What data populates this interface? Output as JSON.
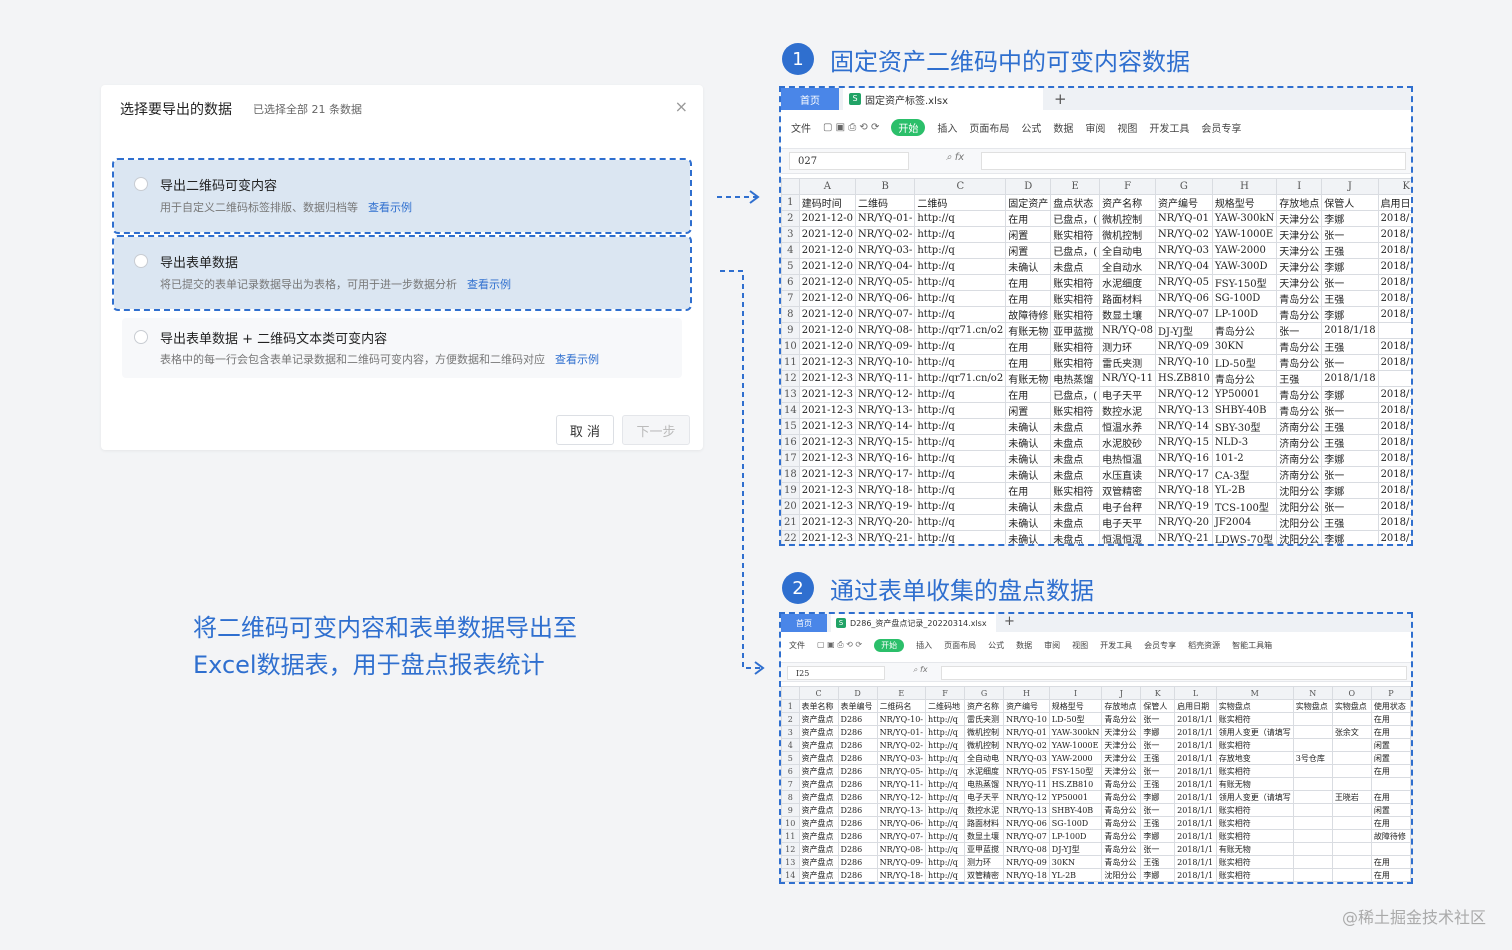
{
  "dialog": {
    "title": "选择要导出的数据",
    "subtitle": "已选择全部 21 条数据",
    "close": "×",
    "options": [
      {
        "title": "导出二维码可变内容",
        "desc": "用于自定义二维码标签排版、数据归档等",
        "link": "查看示例"
      },
      {
        "title": "导出表单数据",
        "desc": "将已提交的表单记录数据导出为表格，可用于进一步数据分析",
        "link": "查看示例"
      },
      {
        "title": "导出表单数据 + 二维码文本类可变内容",
        "desc": "表格中的每一行会包含表单记录数据和二维码可变内容，方便数据和二维码对应",
        "link": "查看示例"
      }
    ],
    "cancel": "取 消",
    "next": "下一步"
  },
  "caption": {
    "line1": "将二维码可变内容和表单数据导出至",
    "line2": "Excel数据表，用于盘点报表统计"
  },
  "section1": {
    "number": "1",
    "heading": "固定资产二维码中的可变内容数据"
  },
  "section2": {
    "number": "2",
    "heading": "通过表单收集的盘点数据"
  },
  "watermark": "@稀土掘金技术社区",
  "sheet1": {
    "home_tab": "首页",
    "file_name": "固定资产标签.xlsx",
    "plus": "+",
    "toolbar": [
      "文件",
      "开始",
      "插入",
      "页面布局",
      "公式",
      "数据",
      "审阅",
      "视图",
      "开发工具",
      "会员专享"
    ],
    "cell_ref": "027",
    "fx": "fx",
    "columns": [
      "A",
      "B",
      "C",
      "D",
      "E",
      "F",
      "G",
      "H",
      "I",
      "J",
      "K"
    ],
    "header_row": [
      "建码时间",
      "二维码",
      "二维码",
      "固定资产",
      "盘点状态",
      "资产名称",
      "资产编号",
      "规格型号",
      "存放地点",
      "保管人",
      "启用日期"
    ],
    "rows": [
      [
        "2021-12-0",
        "NR/YQ-01-",
        "http://q",
        "在用",
        "已盘点，(",
        "微机控制",
        "NR/YQ-01",
        "YAW-300kN",
        "天津分公",
        "李娜",
        "2018/1/18"
      ],
      [
        "2021-12-0",
        "NR/YQ-02-",
        "http://q",
        "闲置",
        "账实相符",
        "微机控制",
        "NR/YQ-02",
        "YAW-1000E",
        "天津分公",
        "张一",
        "2018/1/18"
      ],
      [
        "2021-12-0",
        "NR/YQ-03-",
        "http://q",
        "闲置",
        "已盘点，(",
        "全自动电",
        "NR/YQ-03",
        "YAW-2000",
        "天津分公",
        "王强",
        "2018/1/18"
      ],
      [
        "2021-12-0",
        "NR/YQ-04-",
        "http://q",
        "未确认",
        "未盘点",
        "全自动水",
        "NR/YQ-04",
        "YAW-300D",
        "天津分公",
        "李娜",
        "2018/1/18"
      ],
      [
        "2021-12-0",
        "NR/YQ-05-",
        "http://q",
        "在用",
        "账实相符",
        "水泥细度",
        "NR/YQ-05",
        "FSY-150型",
        "天津分公",
        "张一",
        "2018/1/18"
      ],
      [
        "2021-12-0",
        "NR/YQ-06-",
        "http://q",
        "在用",
        "账实相符",
        "路面材料",
        "NR/YQ-06",
        "SG-100D",
        "青岛分公",
        "王强",
        "2018/1/18"
      ],
      [
        "2021-12-0",
        "NR/YQ-07-",
        "http://q",
        "故障待修",
        "账实相符",
        "数显土壤",
        "NR/YQ-07",
        "LP-100D",
        "青岛分公",
        "李娜",
        "2018/1/18"
      ],
      [
        "2021-12-0",
        "NR/YQ-08-",
        "http://qr71.cn/o2",
        "有账无物",
        "亚甲蓝搅",
        "NR/YQ-08",
        "DJ-YJ型",
        "青岛分公",
        "张一",
        "2018/1/18",
        ""
      ],
      [
        "2021-12-0",
        "NR/YQ-09-",
        "http://q",
        "在用",
        "账实相符",
        "测力环",
        "NR/YQ-09",
        "30KN",
        "青岛分公",
        "王强",
        "2018/1/18"
      ],
      [
        "2021-12-3",
        "NR/YQ-10-",
        "http://q",
        "在用",
        "账实相符",
        "雷氏夹测",
        "NR/YQ-10",
        "LD-50型",
        "青岛分公",
        "张一",
        "2018/1/18"
      ],
      [
        "2021-12-3",
        "NR/YQ-11-",
        "http://qr71.cn/o2",
        "有账无物",
        "电热蒸馏",
        "NR/YQ-11",
        "HS.ZB810",
        "青岛分公",
        "王强",
        "2018/1/18",
        ""
      ],
      [
        "2021-12-3",
        "NR/YQ-12-",
        "http://q",
        "在用",
        "已盘点，(",
        "电子天平",
        "NR/YQ-12",
        "YP50001",
        "青岛分公",
        "李娜",
        "2018/1/18"
      ],
      [
        "2021-12-3",
        "NR/YQ-13-",
        "http://q",
        "闲置",
        "账实相符",
        "数控水泥",
        "NR/YQ-13",
        "SHBY-40B",
        "青岛分公",
        "张一",
        "2018/1/18"
      ],
      [
        "2021-12-3",
        "NR/YQ-14-",
        "http://q",
        "未确认",
        "未盘点",
        "恒温水养",
        "NR/YQ-14",
        "SBY-30型",
        "济南分公",
        "王强",
        "2018/1/18"
      ],
      [
        "2021-12-3",
        "NR/YQ-15-",
        "http://q",
        "未确认",
        "未盘点",
        "水泥胶砂",
        "NR/YQ-15",
        "NLD-3",
        "济南分公",
        "王强",
        "2018/1/18"
      ],
      [
        "2021-12-3",
        "NR/YQ-16-",
        "http://q",
        "未确认",
        "未盘点",
        "电热恒温",
        "NR/YQ-16",
        "101-2",
        "济南分公",
        "李娜",
        "2018/1/18"
      ],
      [
        "2021-12-3",
        "NR/YQ-17-",
        "http://q",
        "未确认",
        "未盘点",
        "水压直读",
        "NR/YQ-17",
        "CA-3型",
        "济南分公",
        "张一",
        "2018/1/18"
      ],
      [
        "2021-12-3",
        "NR/YQ-18-",
        "http://q",
        "在用",
        "账实相符",
        "双管精密",
        "NR/YQ-18",
        "YL-2B",
        "沈阳分公",
        "李娜",
        "2018/1/18"
      ],
      [
        "2021-12-3",
        "NR/YQ-19-",
        "http://q",
        "未确认",
        "未盘点",
        "电子台秤",
        "NR/YQ-19",
        "TCS-100型",
        "沈阳分公",
        "张一",
        "2018/1/18"
      ],
      [
        "2021-12-3",
        "NR/YQ-20-",
        "http://q",
        "未确认",
        "未盘点",
        "电子天平",
        "NR/YQ-20",
        "JF2004",
        "沈阳分公",
        "王强",
        "2018/1/18"
      ],
      [
        "2021-12-3",
        "NR/YQ-21-",
        "http://q",
        "未确认",
        "未盘点",
        "恒温恒湿",
        "NR/YQ-21",
        "LDWS-70型",
        "沈阳分公",
        "李娜",
        "2018/1/18"
      ]
    ]
  },
  "sheet2": {
    "home_tab": "首页",
    "file_name": "D286_资产盘点记录_20220314.xlsx",
    "plus": "+",
    "toolbar": [
      "文件",
      "开始",
      "插入",
      "页面布局",
      "公式",
      "数据",
      "审阅",
      "视图",
      "开发工具",
      "会员专享",
      "稻壳资源",
      "智能工具箱"
    ],
    "cell_ref": "I25",
    "fx": "fx",
    "columns": [
      "C",
      "D",
      "E",
      "F",
      "G",
      "H",
      "I",
      "J",
      "K",
      "L",
      "M",
      "N",
      "O",
      "P"
    ],
    "header_row": [
      "表单名称",
      "表单编号",
      "二维码名",
      "二维码地",
      "资产名称",
      "资产编号",
      "规格型号",
      "存放地点",
      "保管人",
      "启用日期",
      "实物盘点",
      "实物盘点",
      "实物盘点",
      "使用状态"
    ],
    "rows": [
      [
        "资产盘点",
        "D286",
        "NR/YQ-10-",
        "http://q",
        "雷氏夹测",
        "NR/YQ-10",
        "LD-50型",
        "青岛分公",
        "张一",
        "2018/1/1",
        "账实相符",
        "",
        "",
        "在用"
      ],
      [
        "资产盘点",
        "D286",
        "NR/YQ-01-",
        "http://q",
        "微机控制",
        "NR/YQ-01",
        "YAW-300kN",
        "天津分公",
        "李娜",
        "2018/1/1",
        "领用人变更（请填写",
        "",
        "张余文",
        "在用"
      ],
      [
        "资产盘点",
        "D286",
        "NR/YQ-02-",
        "http://q",
        "微机控制",
        "NR/YQ-02",
        "YAW-1000E",
        "天津分公",
        "张一",
        "2018/1/1",
        "账实相符",
        "",
        "",
        "闲置"
      ],
      [
        "资产盘点",
        "D286",
        "NR/YQ-03-",
        "http://q",
        "全自动电",
        "NR/YQ-03",
        "YAW-2000",
        "天津分公",
        "王强",
        "2018/1/1",
        "存放地变",
        "3号仓库",
        "",
        "闲置"
      ],
      [
        "资产盘点",
        "D286",
        "NR/YQ-05-",
        "http://q",
        "水泥细度",
        "NR/YQ-05",
        "FSY-150型",
        "天津分公",
        "张一",
        "2018/1/1",
        "账实相符",
        "",
        "",
        "在用"
      ],
      [
        "资产盘点",
        "D286",
        "NR/YQ-11-",
        "http://q",
        "电热蒸馏",
        "NR/YQ-11",
        "HS.ZB810",
        "青岛分公",
        "王强",
        "2018/1/1",
        "有账无物",
        "",
        "",
        ""
      ],
      [
        "资产盘点",
        "D286",
        "NR/YQ-12-",
        "http://q",
        "电子天平",
        "NR/YQ-12",
        "YP50001",
        "青岛分公",
        "李娜",
        "2018/1/1",
        "领用人变更（请填写",
        "",
        "王晓岩",
        "在用"
      ],
      [
        "资产盘点",
        "D286",
        "NR/YQ-13-",
        "http://q",
        "数控水泥",
        "NR/YQ-13",
        "SHBY-40B",
        "青岛分公",
        "张一",
        "2018/1/1",
        "账实相符",
        "",
        "",
        "闲置"
      ],
      [
        "资产盘点",
        "D286",
        "NR/YQ-06-",
        "http://q",
        "路面材料",
        "NR/YQ-06",
        "SG-100D",
        "青岛分公",
        "王强",
        "2018/1/1",
        "账实相符",
        "",
        "",
        "在用"
      ],
      [
        "资产盘点",
        "D286",
        "NR/YQ-07-",
        "http://q",
        "数显土壤",
        "NR/YQ-07",
        "LP-100D",
        "青岛分公",
        "李娜",
        "2018/1/1",
        "账实相符",
        "",
        "",
        "故障待修"
      ],
      [
        "资产盘点",
        "D286",
        "NR/YQ-08-",
        "http://q",
        "亚甲蓝搅",
        "NR/YQ-08",
        "DJ-YJ型",
        "青岛分公",
        "张一",
        "2018/1/1",
        "有账无物",
        "",
        "",
        ""
      ],
      [
        "资产盘点",
        "D286",
        "NR/YQ-09-",
        "http://q",
        "测力环",
        "NR/YQ-09",
        "30KN",
        "青岛分公",
        "王强",
        "2018/1/1",
        "账实相符",
        "",
        "",
        "在用"
      ],
      [
        "资产盘点",
        "D286",
        "NR/YQ-18-",
        "http://q",
        "双管精密",
        "NR/YQ-18",
        "YL-2B",
        "沈阳分公",
        "李娜",
        "2018/1/1",
        "账实相符",
        "",
        "",
        "在用"
      ]
    ]
  }
}
